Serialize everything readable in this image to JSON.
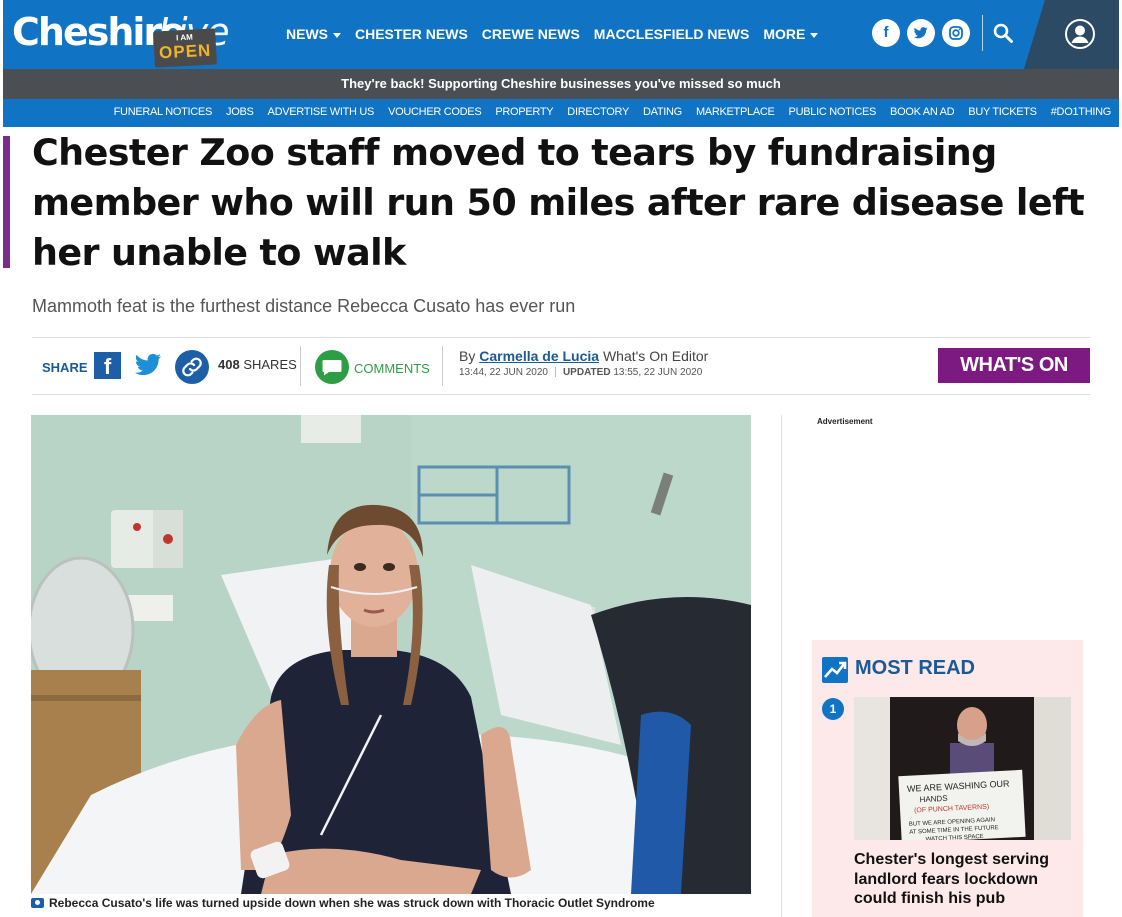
{
  "header": {
    "logo_text": "Cheshire",
    "logo_live": "Live",
    "badge_top": "I AM",
    "badge_main": "OPEN",
    "nav": [
      {
        "label": "NEWS",
        "has_caret": true
      },
      {
        "label": "CHESTER NEWS",
        "has_caret": false
      },
      {
        "label": "CREWE NEWS",
        "has_caret": false
      },
      {
        "label": "MACCLESFIELD NEWS",
        "has_caret": false
      },
      {
        "label": "MORE",
        "has_caret": true
      }
    ],
    "social": {
      "facebook": "f",
      "twitter_icon": "twitter-icon",
      "instagram_icon": "instagram-icon"
    },
    "colors": {
      "brand_blue": "#1073c4",
      "dark_bar": "#4b4f53",
      "account_bg": "#2c4a63"
    }
  },
  "promo": {
    "text": "They're back! Supporting Cheshire businesses you've missed so much"
  },
  "subnav": [
    "FUNERAL NOTICES",
    "JOBS",
    "ADVERTISE WITH US",
    "VOUCHER CODES",
    "PROPERTY",
    "DIRECTORY",
    "DATING",
    "MARKETPLACE",
    "PUBLIC NOTICES",
    "BOOK AN AD",
    "BUY TICKETS",
    "#DO1THING"
  ],
  "article": {
    "headline": "Chester Zoo staff moved to tears by fundraising member who will run 50 miles after rare disease left her unable to walk",
    "standfirst": "Mammoth feat is the furthest distance Rebecca Cusato has ever run",
    "share_label": "SHARE",
    "shares_count": "408",
    "shares_label": "SHARES",
    "comments_label": "COMMENTS",
    "by_prefix": "By",
    "author": "Carmella de Lucia",
    "author_role": "What's On Editor",
    "published": "13:44, 22 JUN 2020",
    "updated_label": "UPDATED",
    "updated": "13:55, 22 JUN 2020",
    "section_tag": "WHAT'S ON",
    "caption": "Rebecca Cusato's life was turned upside down when she was struck down with Thoracic Outlet Syndrome",
    "accent_color": "#7d2c8b"
  },
  "sidebar": {
    "ad_label": "Advertisement",
    "most_read": {
      "title": "MOST READ",
      "items": [
        {
          "rank": "1",
          "headline": "Chester's longest serving landlord fears lockdown could finish his pub",
          "sign_text": "WE ARE WASHING OUR HANDS (OF PUNCH TAVERNS) BUT WE ARE OPENING AGAIN AT SOME TIME IN THE FUTURE WATCH THIS SPACE"
        }
      ]
    }
  }
}
